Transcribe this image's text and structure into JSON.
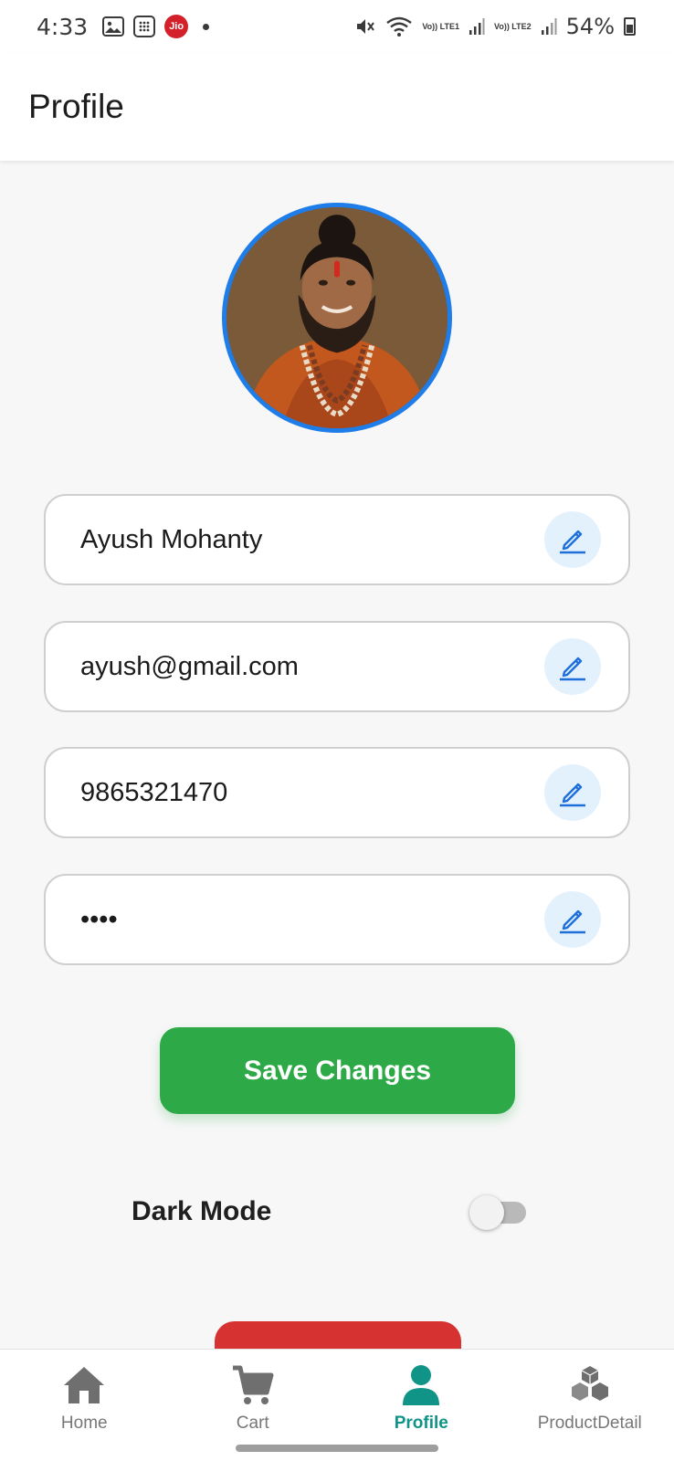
{
  "status_bar": {
    "time": "4:33",
    "carrier_badge": "Jio",
    "lte1": "Vo)) LTE1",
    "lte2": "Vo)) LTE2",
    "battery": "54%"
  },
  "app_bar": {
    "title": "Profile"
  },
  "profile": {
    "avatar_icon": "profile-photo",
    "fields": [
      {
        "value": "Ayush Mohanty",
        "icon": "pencil-icon"
      },
      {
        "value": "ayush@gmail.com",
        "icon": "pencil-icon"
      },
      {
        "value": "9865321470",
        "icon": "pencil-icon"
      },
      {
        "value": "••••",
        "icon": "pencil-icon"
      }
    ],
    "save_label": "Save Changes",
    "dark_mode_label": "Dark Mode",
    "dark_mode_on": false
  },
  "colors": {
    "accent_blue": "#1e7de8",
    "save_green": "#2daa47",
    "logout_red": "#d63232",
    "nav_active": "#109487"
  },
  "bottom_nav": {
    "items": [
      {
        "label": "Home",
        "icon": "home-icon",
        "active": false
      },
      {
        "label": "Cart",
        "icon": "cart-icon",
        "active": false
      },
      {
        "label": "Profile",
        "icon": "person-icon",
        "active": true
      },
      {
        "label": "ProductDetail",
        "icon": "cubes-icon",
        "active": false
      }
    ]
  }
}
